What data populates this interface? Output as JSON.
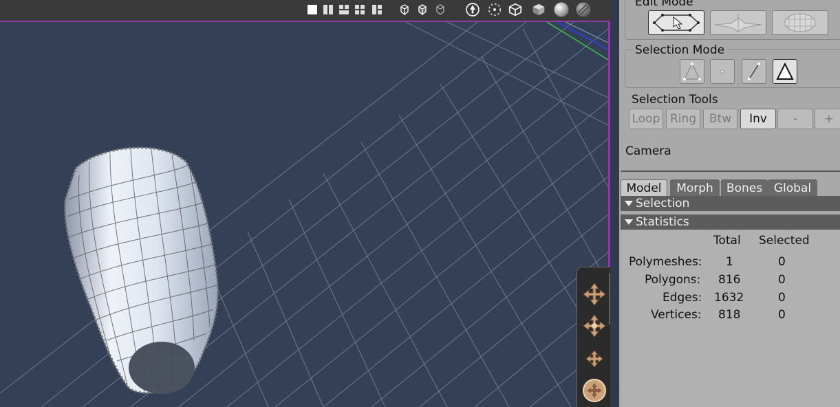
{
  "viewport": {
    "toolbar_icons": [
      "single-view-icon",
      "two-view-icon",
      "three-view-icon",
      "four-view-icon",
      "split-view-icon",
      "wireframe-shape-icon",
      "shaded-wire-shape-icon",
      "hidden-line-shape-icon",
      "normal-icon",
      "vertex-icon",
      "box-icon",
      "solid-cube-icon",
      "smooth-sphere-icon",
      "textured-sphere-icon"
    ]
  },
  "nav_widget": {
    "buttons": [
      "move-xz-icon",
      "move-y-icon",
      "rotate-icon",
      "trackball-icon"
    ]
  },
  "panel": {
    "edit_mode": {
      "title": "Edit Mode",
      "buttons": [
        "select-edit-icon",
        "bone-edit-icon",
        "morph-edit-icon"
      ]
    },
    "selection_mode": {
      "title": "Selection Mode",
      "buttons": [
        "vertex-select-icon",
        "point-select-icon",
        "edge-select-icon",
        "polygon-select-icon"
      ]
    },
    "selection_tools": {
      "title": "Selection Tools",
      "buttons": [
        "Loop",
        "Ring",
        "Btw",
        "Inv",
        "-",
        "+"
      ]
    },
    "camera_label": "Camera",
    "tabs": [
      "Model",
      "Morph",
      "Bones",
      "Global"
    ],
    "sections": {
      "selection": "Selection",
      "statistics": "Statistics"
    },
    "stats": {
      "col_total": "Total",
      "col_selected": "Selected",
      "rows": [
        {
          "label": "Polymeshes:",
          "total": "1",
          "selected": "0"
        },
        {
          "label": "Polygons:",
          "total": "816",
          "selected": "0"
        },
        {
          "label": "Edges:",
          "total": "1632",
          "selected": "0"
        },
        {
          "label": "Vertices:",
          "total": "818",
          "selected": "0"
        }
      ]
    }
  }
}
